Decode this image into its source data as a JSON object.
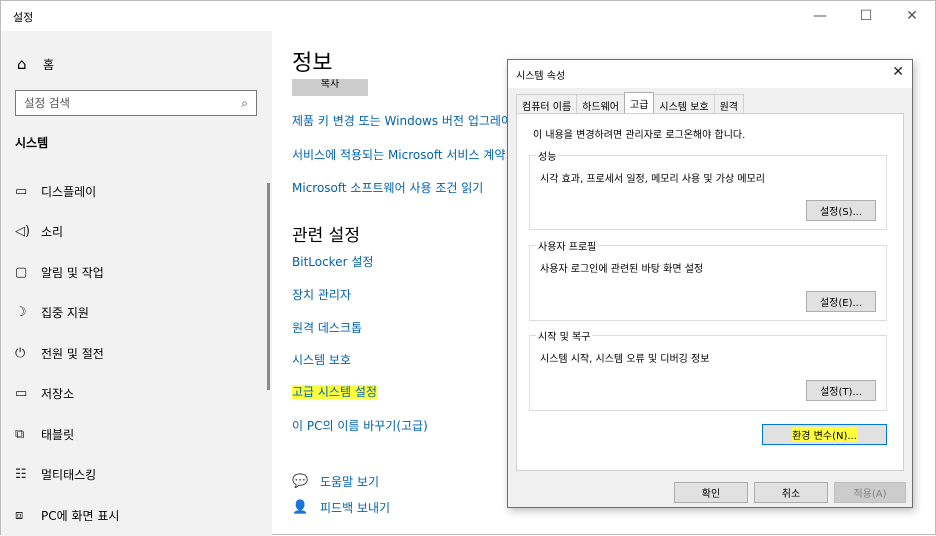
{
  "window": {
    "title": "설정",
    "minimize": "—",
    "maximize": "☐",
    "close": "✕"
  },
  "sidebar": {
    "home_icon": "⌂",
    "home_label": "홈",
    "search_placeholder": "설정 검색",
    "search_icon": "⌕",
    "heading": "시스템",
    "items": [
      {
        "icon": "▭",
        "label": "디스플레이"
      },
      {
        "icon": "◁)",
        "label": "소리"
      },
      {
        "icon": "▢",
        "label": "알림 및 작업"
      },
      {
        "icon": "☽",
        "label": "집중 지원"
      },
      {
        "icon": "⏻",
        "label": "전원 및 절전"
      },
      {
        "icon": "▭",
        "label": "저장소"
      },
      {
        "icon": "⧉",
        "label": "태블릿"
      },
      {
        "icon": "☷",
        "label": "멀티태스킹"
      },
      {
        "icon": "⧈",
        "label": "PC에 화면 표시"
      }
    ]
  },
  "main": {
    "title": "정보",
    "copy_button": "복사",
    "links": [
      "제품 키 변경 또는 Windows 버전 업그레이드",
      "서비스에 적용되는 Microsoft 서비스 계약 읽기",
      "Microsoft 소프트웨어 사용 조건 읽기"
    ],
    "related_heading": "관련 설정",
    "related_links": [
      "BitLocker 설정",
      "장치 관리자",
      "원격 데스크톱",
      "시스템 보호",
      "고급 시스템 설정",
      "이 PC의 이름 바꾸기(고급)"
    ],
    "help": {
      "icon": "💬",
      "label": "도움말 보기"
    },
    "feedback": {
      "icon": "👤",
      "label": "피드백 보내기"
    }
  },
  "dialog": {
    "title": "시스템 속성",
    "close": "✕",
    "tabs": [
      "컴퓨터 이름",
      "하드웨어",
      "고급",
      "시스템 보호",
      "원격"
    ],
    "active_tab": 2,
    "admin_note": "이 내용을 변경하려면 관리자로 로그온해야 합니다.",
    "performance": {
      "title": "성능",
      "desc": "시각 효과, 프로세서 일정, 메모리 사용 및 가상 메모리",
      "button": "설정(S)..."
    },
    "profiles": {
      "title": "사용자 프로필",
      "desc": "사용자 로그인에 관련된 바탕 화면 설정",
      "button": "설정(E)..."
    },
    "startup": {
      "title": "시작 및 복구",
      "desc": "시스템 시작, 시스템 오류 및 디버깅 정보",
      "button": "설정(T)..."
    },
    "env_button": "환경 변수(N)...",
    "ok": "확인",
    "cancel": "취소",
    "apply": "적용(A)"
  }
}
